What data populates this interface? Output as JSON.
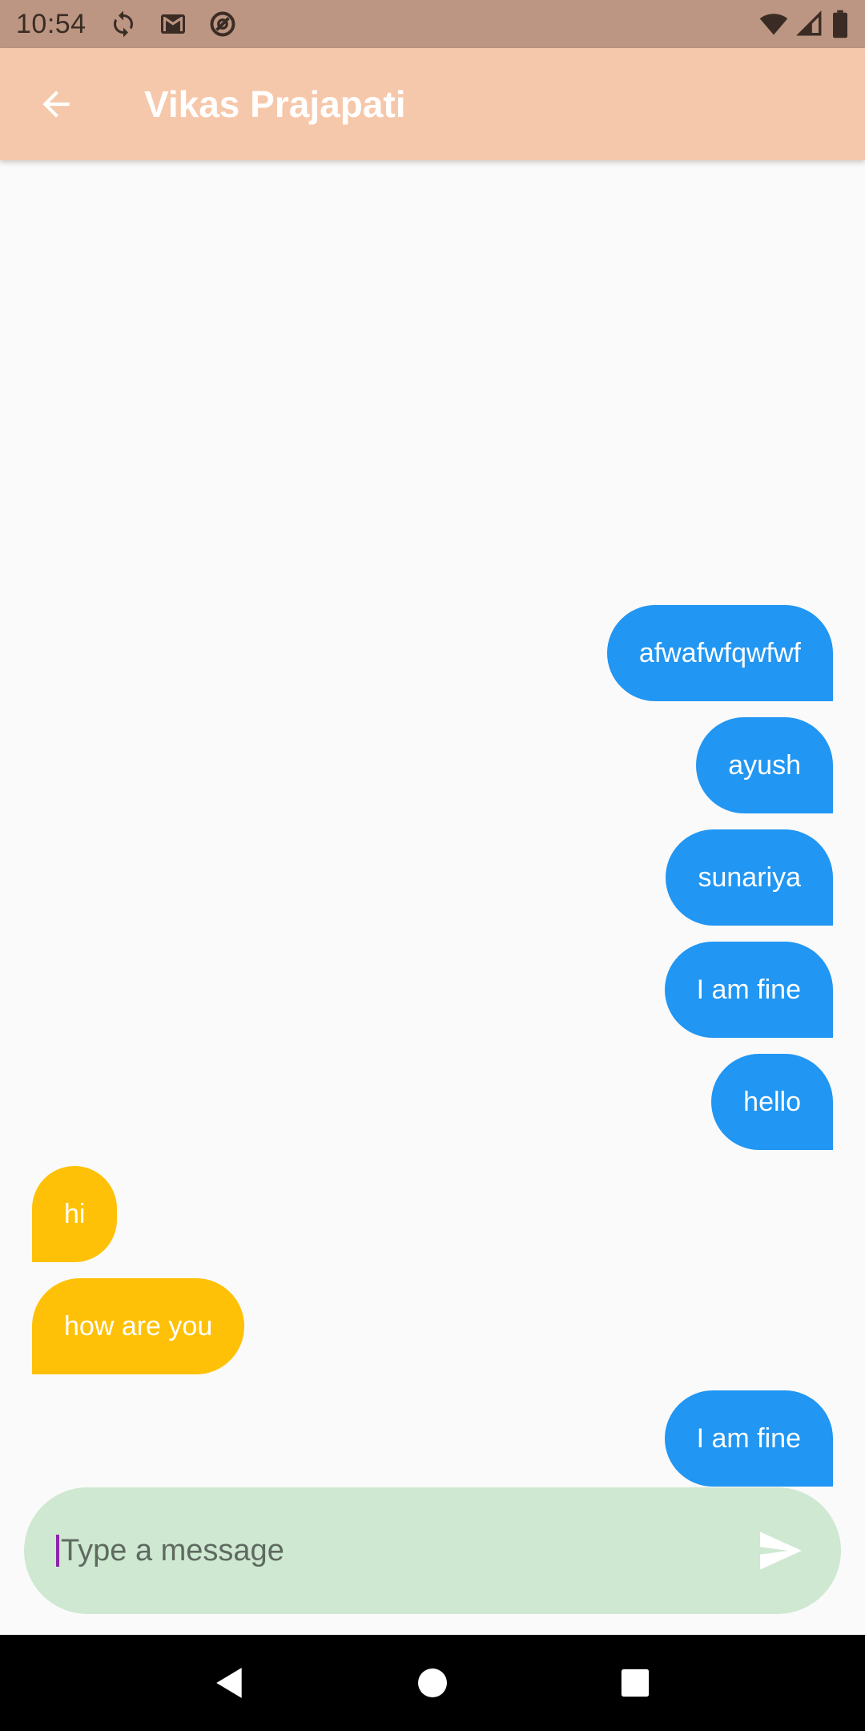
{
  "status_bar": {
    "time": "10:54",
    "icons": [
      "sync-icon",
      "gmail-icon",
      "data-saver-icon",
      "wifi-icon",
      "signal-icon",
      "battery-icon"
    ]
  },
  "app_bar": {
    "title": "Vikas Prajapati",
    "back_icon": "arrow-back-icon",
    "background": "#f6c8ab"
  },
  "messages": [
    {
      "text": "afwafwfqwfwf",
      "direction": "sent"
    },
    {
      "text": "ayush",
      "direction": "sent"
    },
    {
      "text": "sunariya",
      "direction": "sent"
    },
    {
      "text": "I am fine",
      "direction": "sent"
    },
    {
      "text": "hello",
      "direction": "sent"
    },
    {
      "text": "hi",
      "direction": "received"
    },
    {
      "text": "how are you",
      "direction": "received"
    },
    {
      "text": "I am fine",
      "direction": "sent"
    }
  ],
  "colors": {
    "sent_bubble": "#2196f3",
    "received_bubble": "#ffc107",
    "composer_bg": "#cfe8d1"
  },
  "composer": {
    "placeholder": "Type a message",
    "value": "",
    "send_icon": "send-icon"
  },
  "nav_bar": {
    "icons": [
      "back-triangle-icon",
      "home-circle-icon",
      "recents-square-icon"
    ]
  }
}
